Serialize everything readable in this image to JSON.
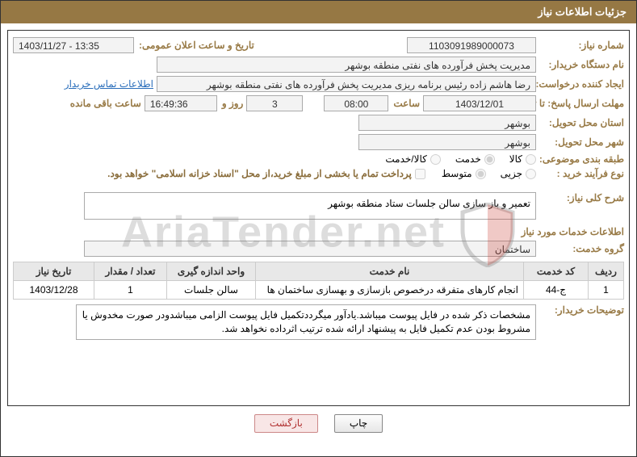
{
  "header": {
    "title": "جزئیات اطلاعات نیاز"
  },
  "labels": {
    "need_no": "شماره نیاز:",
    "announce_dt": "تاریخ و ساعت اعلان عمومی:",
    "buyer_org": "نام دستگاه خریدار:",
    "requester": "ایجاد کننده درخواست:",
    "contact": "اطلاعات تماس خریدار",
    "deadline_to": "مهلت ارسال پاسخ: تا تاریخ:",
    "hour": "ساعت",
    "days_and": "روز و",
    "hours_left": "ساعت باقی مانده",
    "delivery_province": "استان محل تحویل:",
    "delivery_city": "شهر محل تحویل:",
    "category": "طبقه بندی موضوعی:",
    "cat_goods": "کالا",
    "cat_service": "خدمت",
    "cat_goods_service": "کالا/خدمت",
    "proc_type": "نوع فرآیند خرید :",
    "proc_small": "جزیی",
    "proc_medium": "متوسط",
    "treasury_note": "پرداخت تمام یا بخشی از مبلغ خرید،از محل \"اسناد خزانه اسلامی\" خواهد بود.",
    "need_summary": "شرح کلی نیاز:",
    "services_info": "اطلاعات خدمات مورد نیاز",
    "service_group": "گروه خدمت:",
    "buyer_notes": "توضیحات خریدار:",
    "print": "چاپ",
    "back": "بازگشت"
  },
  "values": {
    "need_no": "1103091989000073",
    "announce_dt": "1403/11/27 - 13:35",
    "buyer_org": "مدیریت پخش فرآورده های نفتی منطقه بوشهر",
    "requester": "رضا هاشم زاده رئیس برنامه ریزی مدیریت پخش فرآورده های نفتی منطقه بوشهر",
    "deadline_date": "1403/12/01",
    "deadline_time": "08:00",
    "days_left": "3",
    "time_left": "16:49:36",
    "delivery_province": "بوشهر",
    "delivery_city": "بوشهر",
    "need_summary": "تعمیر و باز سازی سالن جلسات ستاد منطقه بوشهر",
    "service_group": "ساختمان",
    "buyer_notes": "مشخصات ذکر شده در فایل پیوست میباشد.یادآور میگرددتکمیل فایل پیوست الزامی میباشدودر صورت مخدوش یا مشروط بودن عدم تکمیل فایل به پیشنهاد ارائه شده ترتیب اثرداده نخواهد شد."
  },
  "table": {
    "headers": {
      "row": "ردیف",
      "code": "کد خدمت",
      "name": "نام خدمت",
      "unit": "واحد اندازه گیری",
      "qty": "تعداد / مقدار",
      "date": "تاریخ نیاز"
    },
    "rows": [
      {
        "row": "1",
        "code": "ج-44",
        "name": "انجام کارهای متفرقه درخصوص بازسازی و بهسازی ساختمان ها",
        "unit": "سالن جلسات",
        "qty": "1",
        "date": "1403/12/28"
      }
    ]
  },
  "watermark": "AriaTender.net"
}
